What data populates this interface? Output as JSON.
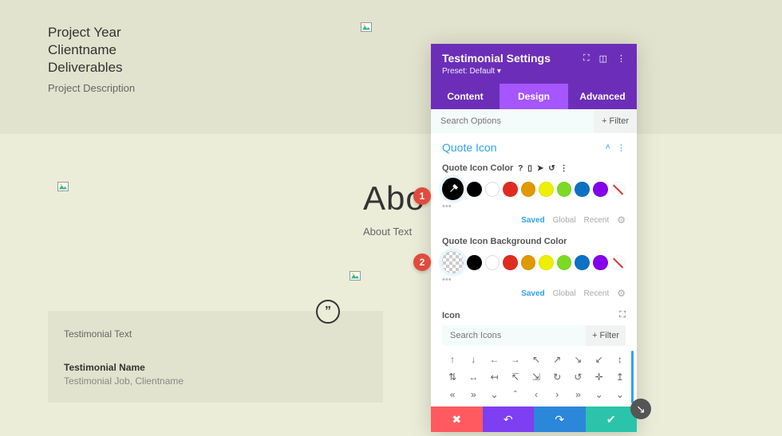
{
  "project": {
    "year": "Project Year",
    "client": "Clientname",
    "deliverables": "Deliverables",
    "description": "Project Description"
  },
  "about": {
    "title": "Abo",
    "text": "About Text"
  },
  "testimonial": {
    "text": "Testimonial Text",
    "name": "Testimonial Name",
    "job": "Testimonial Job, Clientname",
    "quote_glyph": "”"
  },
  "panel": {
    "title": "Testimonial Settings",
    "preset": "Preset: Default ▾",
    "tabs": {
      "content": "Content",
      "design": "Design",
      "advanced": "Advanced"
    },
    "search_placeholder": "Search Options",
    "filter_label": "+  Filter",
    "section_quote_icon": "Quote Icon",
    "label_icon_color": "Quote Icon Color",
    "label_icon_bg": "Quote Icon Background Color",
    "saved": "Saved",
    "global": "Global",
    "recent": "Recent",
    "icon_label": "Icon",
    "icon_search_placeholder": "Search Icons",
    "colors": {
      "black": "#000000",
      "white": "#ffffff",
      "red": "#e02b20",
      "orange": "#e09900",
      "yellow": "#edf000",
      "green": "#7cda24",
      "blue": "#0c71c3",
      "purple": "#8300e9"
    },
    "icons": [
      "↑",
      "↓",
      "←",
      "→",
      "↖",
      "↗",
      "↘",
      "↙",
      "↕",
      "⇅",
      "↔",
      "↤",
      "↸",
      "⇲",
      "↻",
      "↺",
      "✛",
      "↥",
      "«",
      "»",
      "⌄",
      "ˆ",
      "‹",
      "›",
      "»",
      "⌄",
      "⌄"
    ]
  },
  "callouts": {
    "one": "1",
    "two": "2"
  }
}
